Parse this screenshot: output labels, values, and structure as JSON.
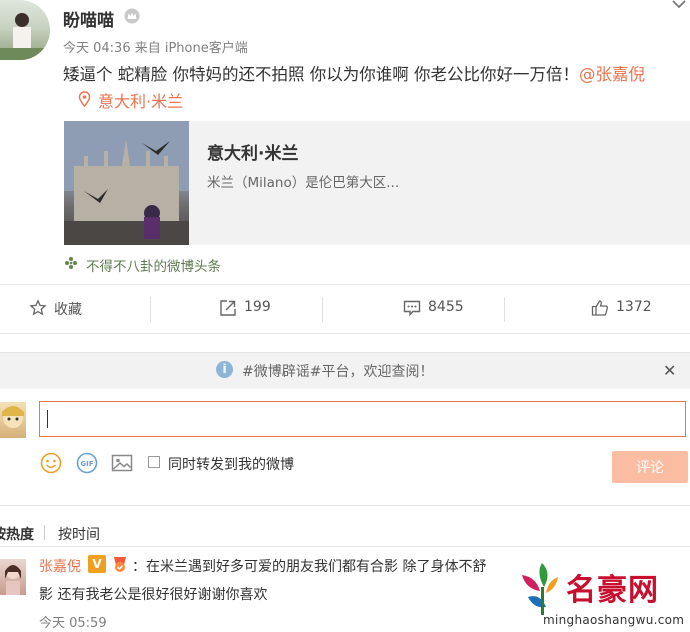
{
  "post": {
    "username": "盼喵喵",
    "meta": "今天 04:36 来自 iPhone客户端",
    "text_main": "矮逼个 蛇精脸 你特妈的还不拍照 你以为你谁啊 你老公比你好一万倍！",
    "mention": "@张嘉倪",
    "location": "意大利·米兰",
    "icons": [
      "crown-icon",
      "chevron-down-icon",
      "location-pin-icon"
    ]
  },
  "card": {
    "title": "意大利·米兰",
    "desc": "米兰（Milano）是伦巴第大区..."
  },
  "source": {
    "label": "不得不八卦的微博头条"
  },
  "actions": {
    "favorite": "收藏",
    "repost": "199",
    "comment": "8455",
    "like": "1372"
  },
  "notice": {
    "text": "#微博辟谣#平台，欢迎查阅！",
    "info": "i",
    "close": "✕"
  },
  "composer": {
    "placeholder": "",
    "repost_label": "同时转发到我的微博",
    "submit": "评论"
  },
  "sort": {
    "hot": "按热度",
    "time": "按时间"
  },
  "comment": {
    "user": "张嘉倪",
    "badge": "V",
    "line1": "：在米兰遇到好多可爱的朋友我们都有合影 除了身体不舒",
    "line2": "影 还有我老公是很好很好谢谢你喜欢",
    "time": "今天 05:59"
  },
  "watermark": {
    "text": "名豪网",
    "url": "minghaoshangwu.com"
  },
  "colors": {
    "accent": "#eb7350",
    "button_disabled": "#fbbda2",
    "notice_bg": "#f2f2f2"
  }
}
